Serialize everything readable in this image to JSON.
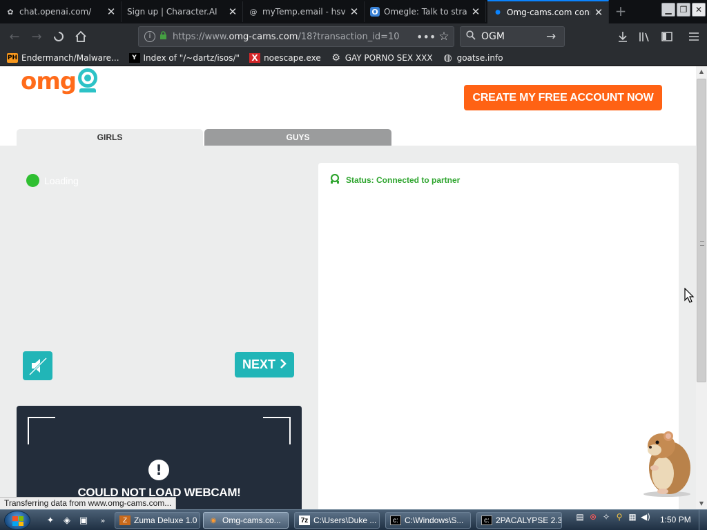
{
  "browser": {
    "tabs": [
      {
        "title": "chat.openai.com/",
        "favicon": "openai-icon"
      },
      {
        "title": "Sign up | Character.AI",
        "favicon": "none"
      },
      {
        "title": "myTemp.email - hsv",
        "favicon": "at-icon"
      },
      {
        "title": "Omegle: Talk to stra",
        "favicon": "omegle-icon"
      },
      {
        "title": "Omg-cams.com conn",
        "favicon": "loading-dot"
      }
    ],
    "url": {
      "prefix": "https://www.",
      "domain": "omg-cams.com",
      "path": "/18?transaction_id=10"
    },
    "search_value": "OGM",
    "bookmarks": [
      {
        "label": "Endermanch/Malware...",
        "icon": "pornhub-icon",
        "icon_text": "PH"
      },
      {
        "label": "Index of \"/~dartz/isos/\"",
        "icon": "yc-icon",
        "icon_text": "Y"
      },
      {
        "label": "noescape.exe",
        "icon": "x-icon",
        "icon_text": "X"
      },
      {
        "label": "GAY PORNO SEX XXX",
        "icon": "gear-icon",
        "icon_text": "⚙"
      },
      {
        "label": "goatse.info",
        "icon": "globe-icon",
        "icon_text": "◍"
      }
    ],
    "status_text": "Transferring data from www.omg-cams.com..."
  },
  "site": {
    "logo_text": "omg",
    "cta_label": "CREATE MY FREE ACCOUNT NOW",
    "tabs": {
      "girls": "GIRLS",
      "guys": "GUYS"
    },
    "loading_label": "Loading",
    "next_label": "NEXT",
    "webcam_error": "COULD NOT LOAD WEBCAM!",
    "chat_status": "Status: Connected to partner"
  },
  "taskbar": {
    "items": [
      {
        "label": "Zuma Deluxe 1.0",
        "icon": "zuma-icon"
      },
      {
        "label": "Omg-cams.co...",
        "icon": "firefox-icon"
      },
      {
        "label": "C:\\Users\\Duke ...",
        "icon": "7zip-icon"
      },
      {
        "label": "C:\\Windows\\S...",
        "icon": "cmd-icon"
      },
      {
        "label": "2PACALYPSE 2.3",
        "icon": "cmd-icon"
      }
    ],
    "clock": "1:50 PM"
  },
  "colors": {
    "accent_orange": "#ff6214",
    "teal": "#21b5b7",
    "status_green": "#2fa52f"
  }
}
